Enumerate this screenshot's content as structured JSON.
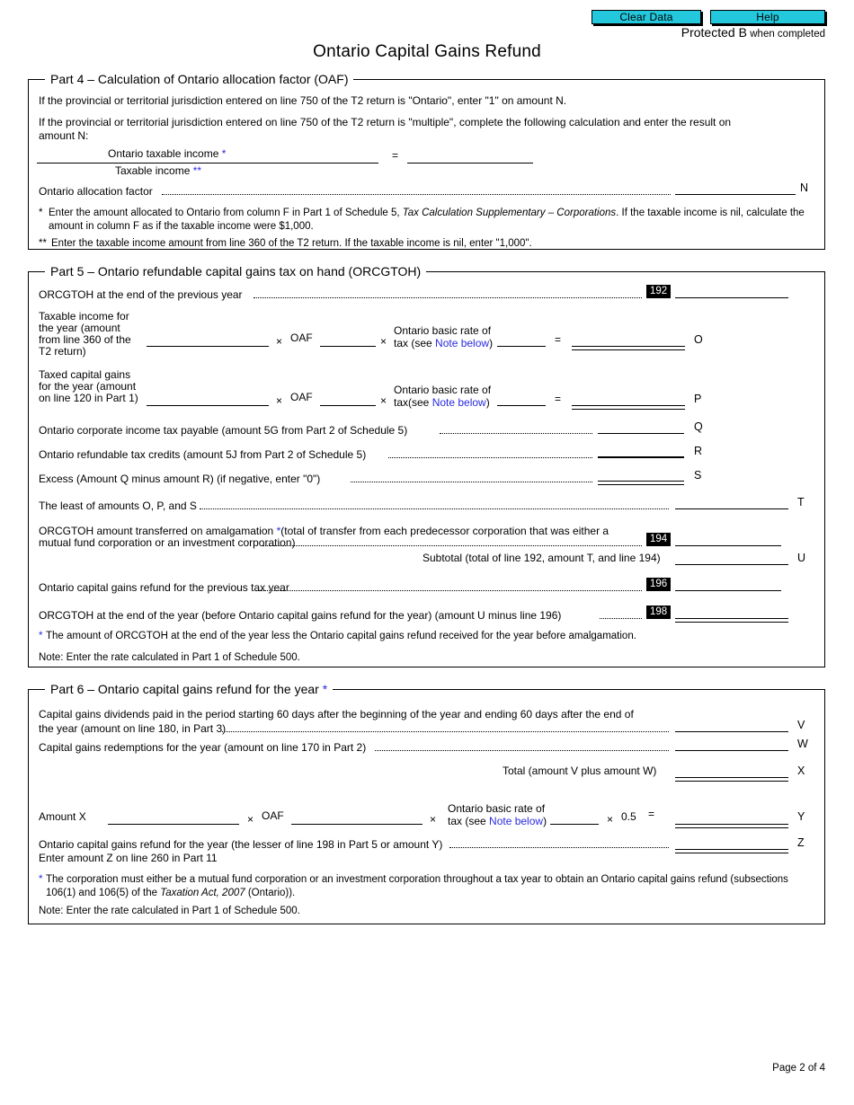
{
  "toolbar": {
    "clear_data_label": "Clear Data",
    "help_label": "Help"
  },
  "header": {
    "protected_b": "Protected B",
    "when_completed": "when completed",
    "title": "Ontario Capital Gains Refund"
  },
  "part4": {
    "heading": "Part 4 – Calculation of Ontario allocation factor (OAF)",
    "intro1": "If the provincial or territorial jurisdiction entered on line 750 of the T2 return is \"Ontario\", enter \"1\" on amount N.",
    "intro2": "If the provincial or territorial jurisdiction entered on line 750 of the T2 return is \"multiple\", complete the following calculation and enter the result on amount N:",
    "fraction_numerator": "Ontario taxable income",
    "fraction_numerator_mark": "*",
    "fraction_denominator": "Taxable income",
    "fraction_denominator_mark": "**",
    "equals": "=",
    "oaf_label": "Ontario allocation factor",
    "oaf_amount_letter": "N",
    "footnote1_mark": "*",
    "footnote1_a": "Enter the amount allocated to Ontario from column F in Part 1 of Schedule 5, ",
    "footnote1_italic": "Tax Calculation Supplementary – Corporations",
    "footnote1_b": ". If the taxable income is nil, calculate the amount in column F as if the taxable income were $1,000.",
    "footnote2_mark": "**",
    "footnote2": "Enter the taxable income amount from line 360 of the T2 return. If the taxable income is nil, enter \"1,000\"."
  },
  "part5": {
    "heading": "Part 5 – Ontario refundable capital gains tax on hand (ORCGTOH)",
    "row_192_label": "ORCGTOH at the end of the previous year",
    "line_192": "192",
    "taxable_income_label": "Taxable income for\nthe year (amount\nfrom line 360 of the\nT2 return)",
    "taxable_income_l1": "Taxable income for",
    "taxable_income_l2": "the year (amount",
    "taxable_income_l3": "from line 360 of the",
    "taxable_income_l4": "T2 return)",
    "times": "×",
    "oaf": "OAF",
    "rate_l1": "Ontario basic rate of",
    "rate_l2_pre": "tax (see ",
    "rate_note_link": "Note below",
    "rate_l2_post": ")",
    "equals": "=",
    "amount_O": "O",
    "taxed_gains_l1": "Taxed capital gains",
    "taxed_gains_l2": "for the year (amount",
    "taxed_gains_l3": "on line 120 in Part 1)",
    "rate2_l2_pre": "tax(see ",
    "amount_P": "P",
    "row_Q_label": "Ontario corporate income tax payable (amount 5G from Part 2 of Schedule 5)",
    "amount_Q": "Q",
    "row_R_label": "Ontario refundable tax credits (amount 5J  from Part 2 of Schedule 5)",
    "amount_R": "R",
    "row_S_label": "Excess (Amount Q minus amount R) (if negative, enter \"0\")",
    "amount_S": "S",
    "row_T_label": "The least of amounts O, P, and S",
    "amount_T": "T",
    "row_194_l1_a": "ORCGTOH amount transferred on amalgamation ",
    "row_194_l1_mark": "*",
    "row_194_l1_b": "(total of transfer from each predecessor corporation that was either a",
    "row_194_l2": "mutual fund corporation or an investment corporation)",
    "line_194": "194",
    "subtotal_label": "Subtotal (total of line 192, amount T, and line 194)",
    "amount_U": "U",
    "row_196_label": "Ontario capital gains refund for the previous tax year",
    "line_196": "196",
    "row_198_label": "ORCGTOH at the end of the year (before Ontario capital gains refund for the year) (amount U minus line 196)",
    "line_198": "198",
    "footnote_mark": "*",
    "footnote": "The amount of ORCGTOH at the end of the year less the Ontario capital gains refund received for the year before amalgamation.",
    "note": "Note: Enter the rate calculated in Part 1 of Schedule 500."
  },
  "part6": {
    "heading": "Part 6 – Ontario capital gains refund for the year",
    "heading_mark": "*",
    "row_V_l1": "Capital gains dividends paid in the period starting 60 days after the beginning of the year and ending 60 days after the end of",
    "row_V_l2": "the year (amount on line 180, in Part 3)",
    "amount_V": "V",
    "row_W_label": "Capital gains redemptions for the year (amount on line 170 in Part 2)",
    "amount_W": "W",
    "total_label": "Total (amount V plus amount W)",
    "amount_X": "X",
    "amount_x_label": "Amount X",
    "times": "×",
    "oaf": "OAF",
    "rate_l1": "Ontario basic rate of",
    "rate_l2_pre": "tax (see ",
    "rate_note_link": "Note below",
    "rate_l2_post": ")",
    "half": "0.5",
    "equals": "=",
    "amount_Y": "Y",
    "row_Z_label": "Ontario capital gains refund for the year (the lesser of line 198 in Part 5 or amount Y)",
    "amount_Z": "Z",
    "row_Z_sub": "Enter amount Z on line 260 in Part 11",
    "footnote_mark": "*",
    "footnote_a": "The corporation must either be a mutual fund corporation or an investment corporation throughout a tax year to obtain an Ontario capital gains refund (subsections 106(1) and 106(5) of the ",
    "footnote_italic": "Taxation Act, 2007",
    "footnote_b": " (Ontario)).",
    "note": "Note: Enter the rate calculated in Part 1 of Schedule 500."
  },
  "footer": {
    "page": "Page 2 of 4"
  },
  "fields": {
    "empty": ""
  }
}
